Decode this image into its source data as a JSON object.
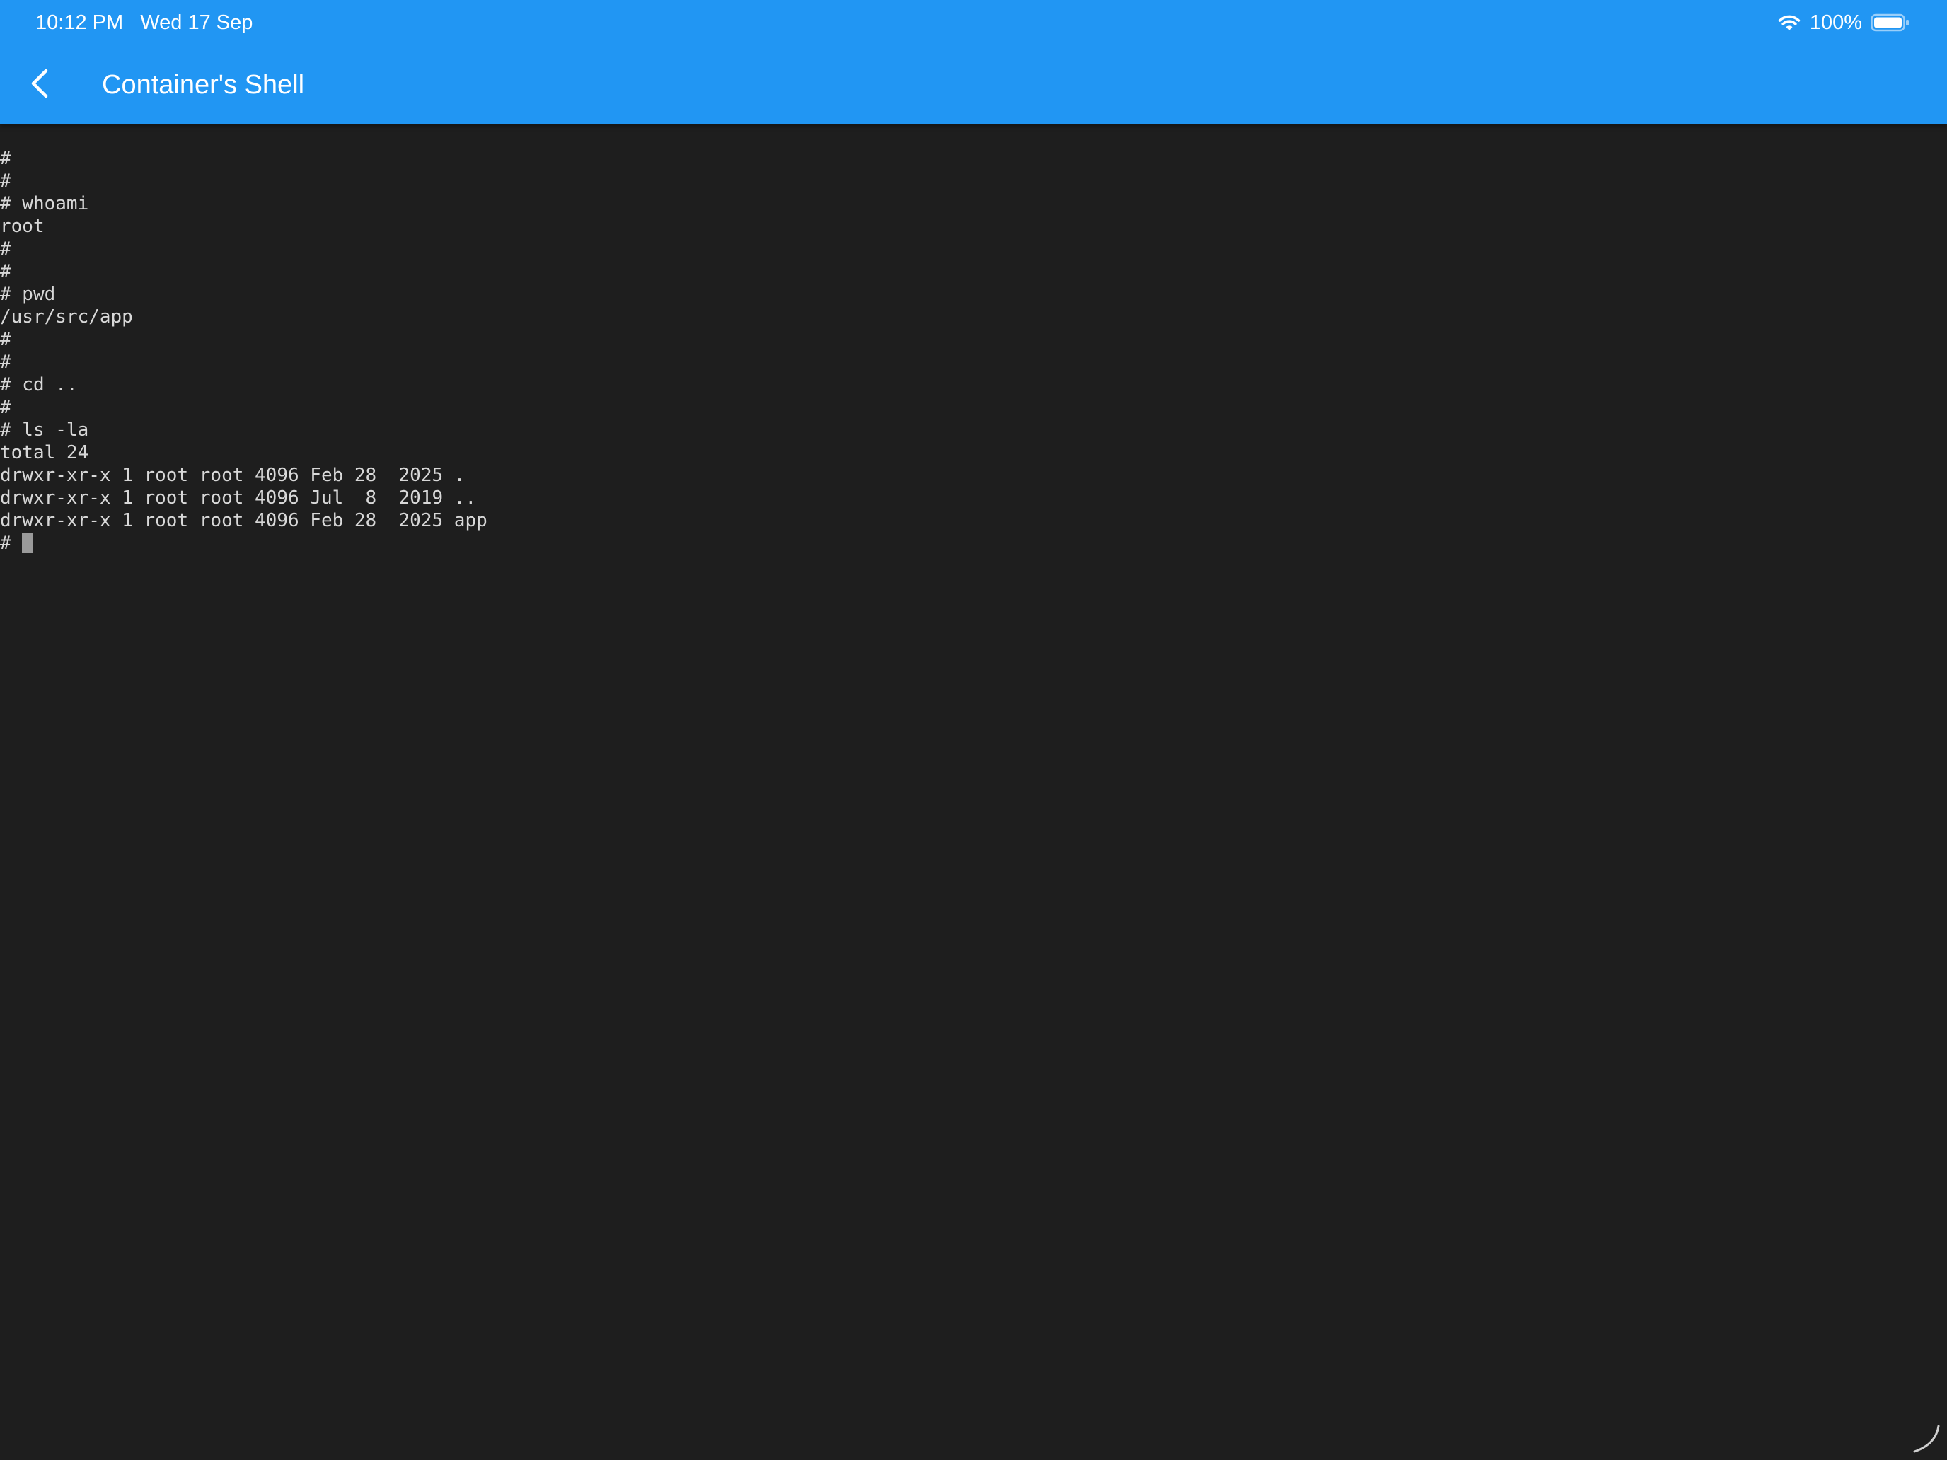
{
  "status_bar": {
    "time": "10:12 PM",
    "date": "Wed 17 Sep",
    "battery_text": "100%",
    "icons": [
      "wifi-icon",
      "battery-icon"
    ]
  },
  "app_bar": {
    "back_icon": "chevron-left-icon",
    "title": "Container's Shell",
    "color": "#2196f3"
  },
  "terminal": {
    "background": "#1e1e1e",
    "lines": [
      "#",
      "#",
      "# whoami",
      "root",
      "#",
      "#",
      "# pwd",
      "/usr/src/app",
      "#",
      "#",
      "# cd ..",
      "#",
      "# ls -la",
      "total 24",
      "drwxr-xr-x 1 root root 4096 Feb 28  2025 .",
      "drwxr-xr-x 1 root root 4096 Jul  8  2019 ..",
      "drwxr-xr-x 1 root root 4096 Feb 28  2025 app"
    ],
    "prompt": "# "
  }
}
